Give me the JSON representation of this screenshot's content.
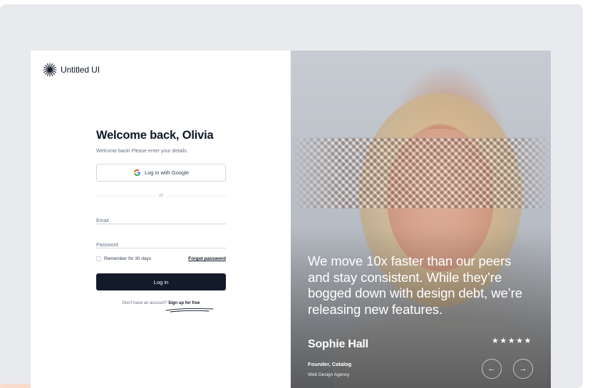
{
  "brand": {
    "name": "Untitled UI"
  },
  "form": {
    "title": "Welcome back, Olivia",
    "subtitle": "Welcome back! Please enter your details.",
    "google_button": "Log in with Google",
    "divider": "or",
    "email_placeholder": "Email",
    "password_placeholder": "Password",
    "remember": "Remember for 30 days",
    "forgot": "Forgot password",
    "login_button": "Log in",
    "signup_prompt": "Don't have an account?",
    "signup_link": "Sign up for free"
  },
  "testimonial": {
    "quote": "We move 10x faster than our peers and stay consistent. While they’re bogged down with design debt, we’re releasing new features.",
    "name": "Sophie Hall",
    "rating": 5,
    "stars": "★★★★★",
    "role": "Founder, Catalog",
    "company": "Web Design Agency"
  },
  "icons": [
    "logo-mark-icon",
    "google-icon",
    "arrow-left-icon",
    "arrow-right-icon",
    "star-icon"
  ],
  "colors": {
    "primary_button": "#131a2a",
    "text_primary": "#101828",
    "text_secondary": "#667085",
    "border": "#d0d5dd"
  }
}
